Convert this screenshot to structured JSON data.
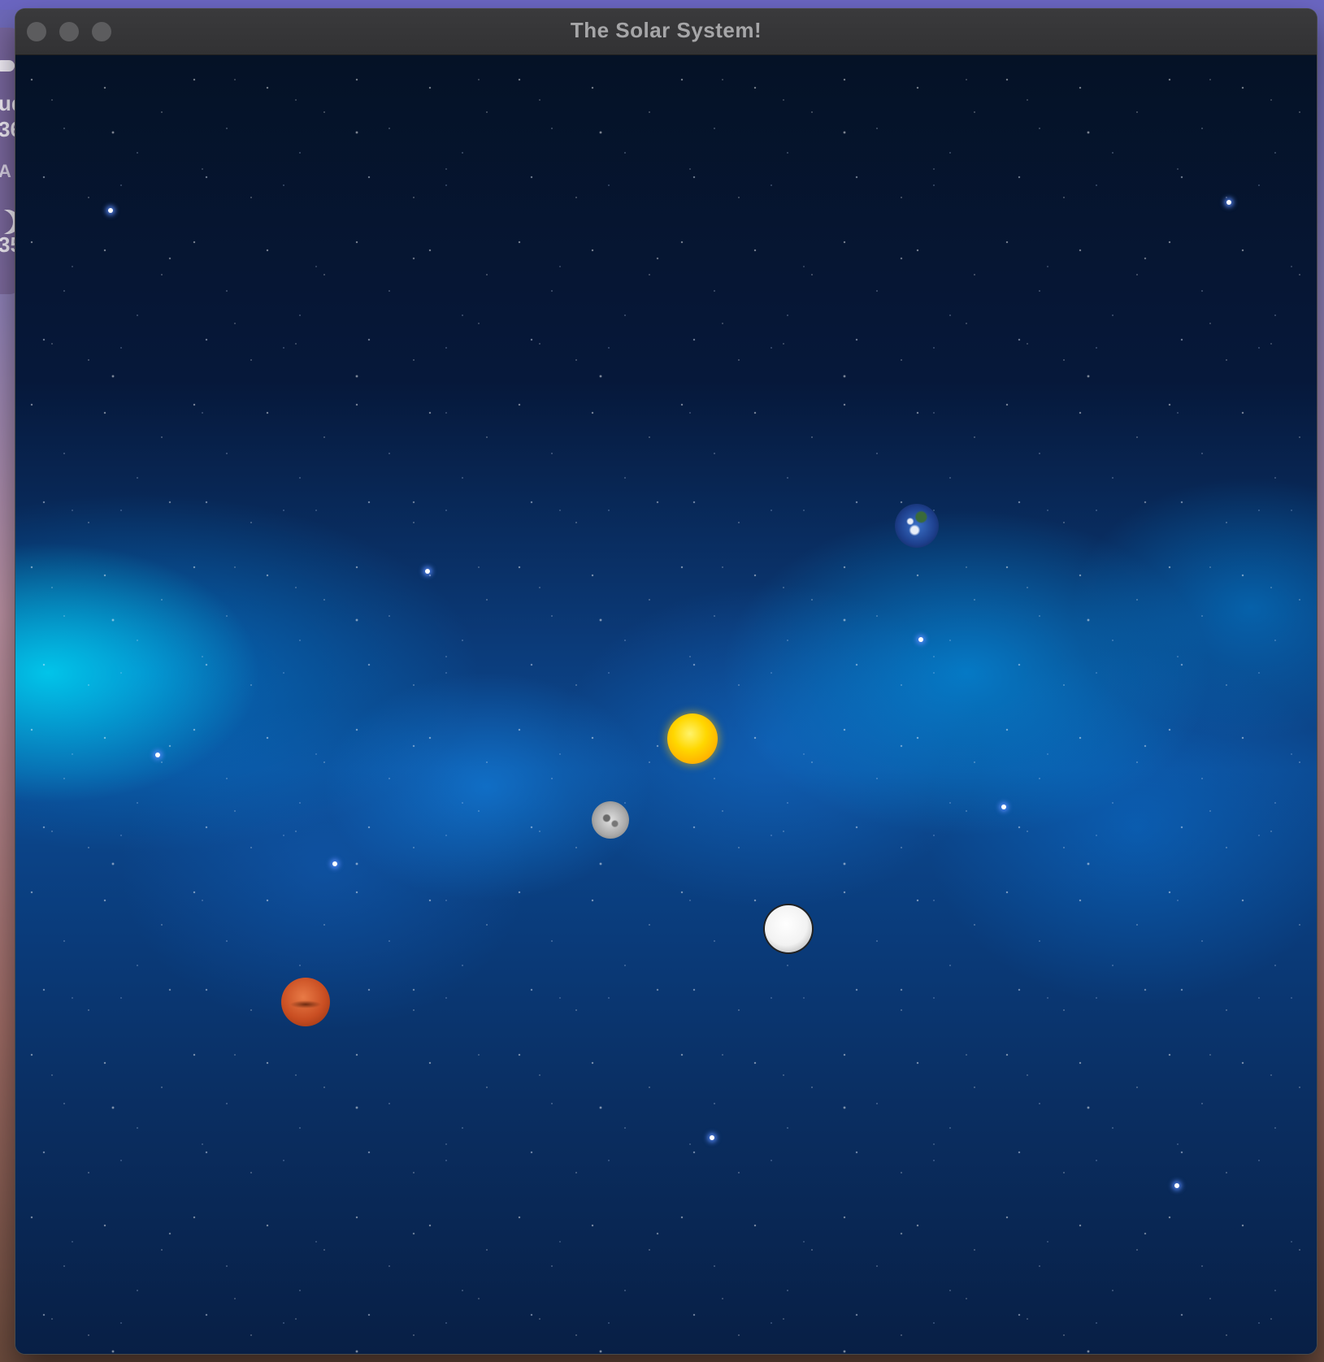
{
  "window": {
    "title": "The Solar System!"
  },
  "widget": {
    "line1": "ud",
    "line2": "36",
    "line3": "A",
    "line4": "35"
  },
  "scene": {
    "bodies": [
      {
        "name": "sun",
        "color": "#ffd700"
      },
      {
        "name": "earth",
        "color": "#2a5bb0"
      },
      {
        "name": "moon",
        "color": "#a8a8a8"
      },
      {
        "name": "white-planet",
        "color": "#f2f2f2"
      },
      {
        "name": "mars",
        "color": "#c94e22"
      }
    ]
  }
}
